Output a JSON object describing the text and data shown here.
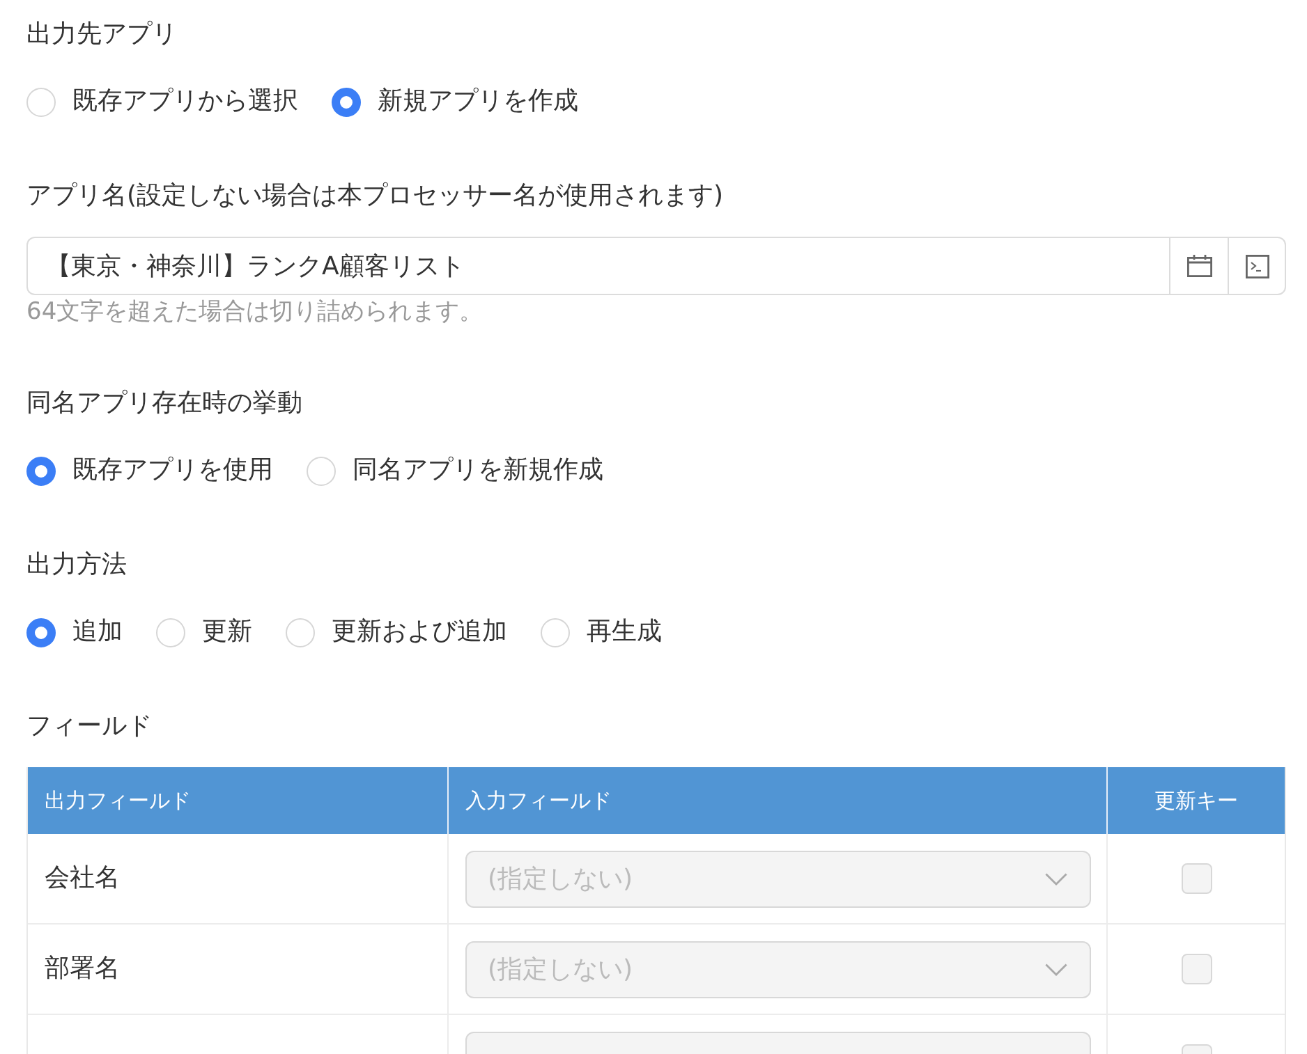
{
  "sections": [
    {
      "kind": "radio_group",
      "label": "出力先アプリ",
      "options": [
        {
          "label": "既存アプリから選択",
          "selected": false
        },
        {
          "label": "新規アプリを作成",
          "selected": true
        }
      ]
    },
    {
      "kind": "text_field",
      "label": "アプリ名(設定しない場合は本プロセッサー名が使用されます)",
      "value": "【東京・神奈川】ランクA顧客リスト",
      "hint": "64文字を超えた場合は切り詰められます。"
    },
    {
      "kind": "radio_group",
      "label": "同名アプリ存在時の挙動",
      "options": [
        {
          "label": "既存アプリを使用",
          "selected": true
        },
        {
          "label": "同名アプリを新規作成",
          "selected": false
        }
      ]
    },
    {
      "kind": "radio_group",
      "label": "出力方法",
      "options": [
        {
          "label": "追加",
          "selected": true
        },
        {
          "label": "更新",
          "selected": false
        },
        {
          "label": "更新および追加",
          "selected": false
        },
        {
          "label": "再生成",
          "selected": false
        }
      ]
    },
    {
      "kind": "field_table",
      "label": "フィールド",
      "columns": [
        "出力フィールド",
        "入力フィールド",
        "更新キー"
      ],
      "rows": [
        {
          "output_field": "会社名",
          "input_field": {
            "placeholder": "(指定しない)",
            "disabled": true
          },
          "update_key": {
            "checked": false
          }
        },
        {
          "output_field": "部署名",
          "input_field": {
            "placeholder": "(指定しない)",
            "disabled": true
          },
          "update_key": {
            "checked": false
          }
        },
        {
          "input_field": {
            "disabled": true
          },
          "update_key": {
            "checked": false
          }
        }
      ]
    }
  ]
}
